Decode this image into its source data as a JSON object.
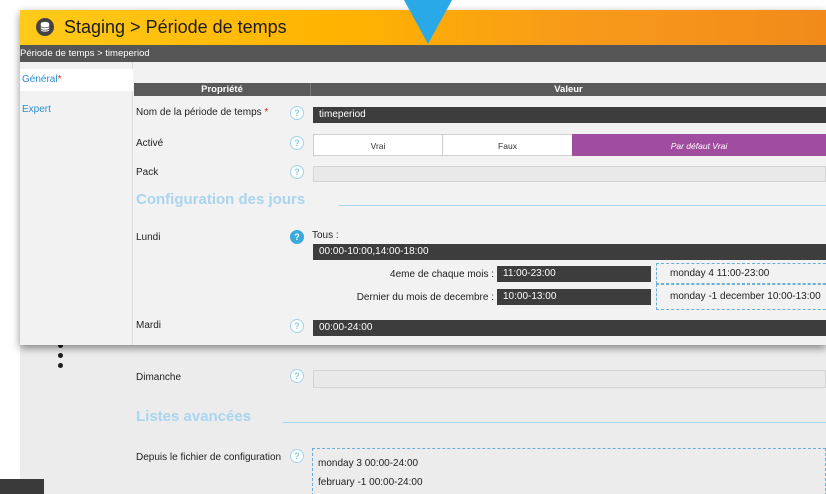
{
  "window": {
    "title": "Staging > Période de temps",
    "breadcrumb": "Période de temps > timeperiod"
  },
  "sidebar": {
    "items": [
      {
        "label": "Général",
        "required": "*"
      },
      {
        "label": "Expert"
      }
    ]
  },
  "table_header": {
    "property": "Propriété",
    "value": "Valeur"
  },
  "fields": {
    "name": {
      "label": "Nom de la période de temps",
      "required": "*",
      "value": "timeperiod"
    },
    "active": {
      "label": "Activé",
      "options": [
        "Vrai",
        "Faux",
        "Par défaut Vrai"
      ],
      "selected": "Par défaut Vrai"
    },
    "pack": {
      "label": "Pack",
      "value": ""
    }
  },
  "days_section": {
    "title": "Configuration des jours",
    "lundi": {
      "label": "Lundi",
      "all_label": "Tous :",
      "all_value": "00:00-10:00,14:00-18:00",
      "exceptions": [
        {
          "label": "4eme de chaque mois :",
          "value": "11:00-23:00",
          "preview": "monday 4 11:00-23:00"
        },
        {
          "label": "Dernier du mois de decembre :",
          "value": "10:00-13:00",
          "preview": "monday -1 december 10:00-13:00"
        }
      ]
    },
    "mardi": {
      "label": "Mardi",
      "value": "00:00-24:00"
    },
    "dimanche": {
      "label": "Dimanche",
      "value": ""
    }
  },
  "advanced_section": {
    "title": "Listes avancées",
    "from_config": {
      "label": "Depuis le fichier de configuration",
      "lines": [
        "monday 3 00:00-24:00",
        "february -1 00:00-24:00"
      ]
    }
  },
  "help_glyph": "?",
  "icons": {
    "database": "database-icon",
    "help": "help-icon"
  },
  "colors": {
    "accent_blue": "#29a9e8",
    "title_gradient_start": "#ffca1a",
    "title_gradient_end": "#f28a1a",
    "selected_purple": "#a04d9f",
    "section_title": "#a8d5ef",
    "link_blue": "#2a8fd0",
    "dark_field": "#3d3d3d"
  }
}
